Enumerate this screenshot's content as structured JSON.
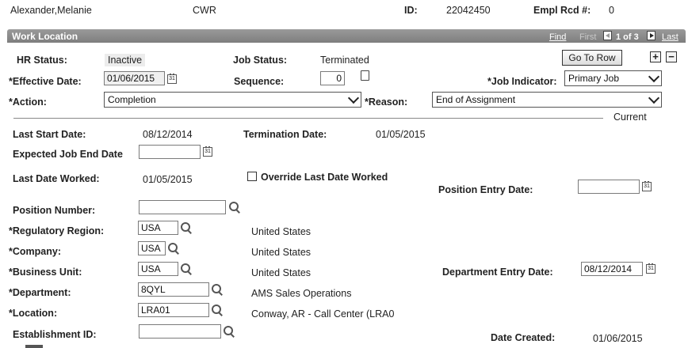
{
  "header": {
    "employee_name": "Alexander,Melanie",
    "employee_type": "CWR",
    "id_label": "ID:",
    "id_value": "22042450",
    "empl_rcd_label": "Empl Rcd #:",
    "empl_rcd_value": "0"
  },
  "section": {
    "title": "Work Location",
    "nav": {
      "find": "Find",
      "first": "First",
      "position": "1 of 3",
      "last": "Last"
    }
  },
  "status": {
    "hr_status_label": "HR Status:",
    "hr_status_value": "Inactive",
    "job_status_label": "Job Status:",
    "job_status_value": "Terminated",
    "go_to_row": "Go To Row",
    "add": "+",
    "remove": "−"
  },
  "effective": {
    "effective_date_label": "*Effective Date:",
    "effective_date_value": "01/06/2015",
    "sequence_label": "Sequence:",
    "sequence_value": "0",
    "job_indicator_label": "*Job Indicator:",
    "job_indicator_value": "Primary Job"
  },
  "action": {
    "action_label": "*Action:",
    "action_value": "Completion",
    "reason_label": "*Reason:",
    "reason_value": "End of Assignment"
  },
  "current_label": "Current",
  "dates": {
    "last_start_label": "Last Start Date:",
    "last_start_value": "08/12/2014",
    "termination_label": "Termination Date:",
    "termination_value": "01/05/2015",
    "expected_end_label": "Expected Job End Date",
    "expected_end_value": "",
    "last_worked_label": "Last Date Worked:",
    "last_worked_value": "01/05/2015",
    "override_label": "Override Last Date Worked",
    "override_checked": false,
    "position_entry_label": "Position Entry Date:",
    "position_entry_value": ""
  },
  "org": {
    "position_number_label": "Position Number:",
    "position_number_value": "",
    "regulatory_region_label": "*Regulatory Region:",
    "regulatory_region_value": "USA",
    "regulatory_region_desc": "United States",
    "company_label": "*Company:",
    "company_value": "USA",
    "company_desc": "United States",
    "business_unit_label": "*Business Unit:",
    "business_unit_value": "USA",
    "business_unit_desc": "United States",
    "department_entry_label": "Department Entry Date:",
    "department_entry_value": "08/12/2014",
    "department_label": "*Department:",
    "department_value": "8QYL",
    "department_desc": "AMS Sales Operations",
    "location_label": "*Location:",
    "location_value": "LRA01",
    "location_desc": "Conway, AR - Call Center (LRA0",
    "establishment_label": "Establishment ID:",
    "establishment_value": "",
    "date_created_label": "Date Created:",
    "date_created_value": "01/06/2015"
  },
  "icons": {
    "calendar": "calendar-icon",
    "lookup": "lookup-icon",
    "memo": "memo-icon"
  }
}
